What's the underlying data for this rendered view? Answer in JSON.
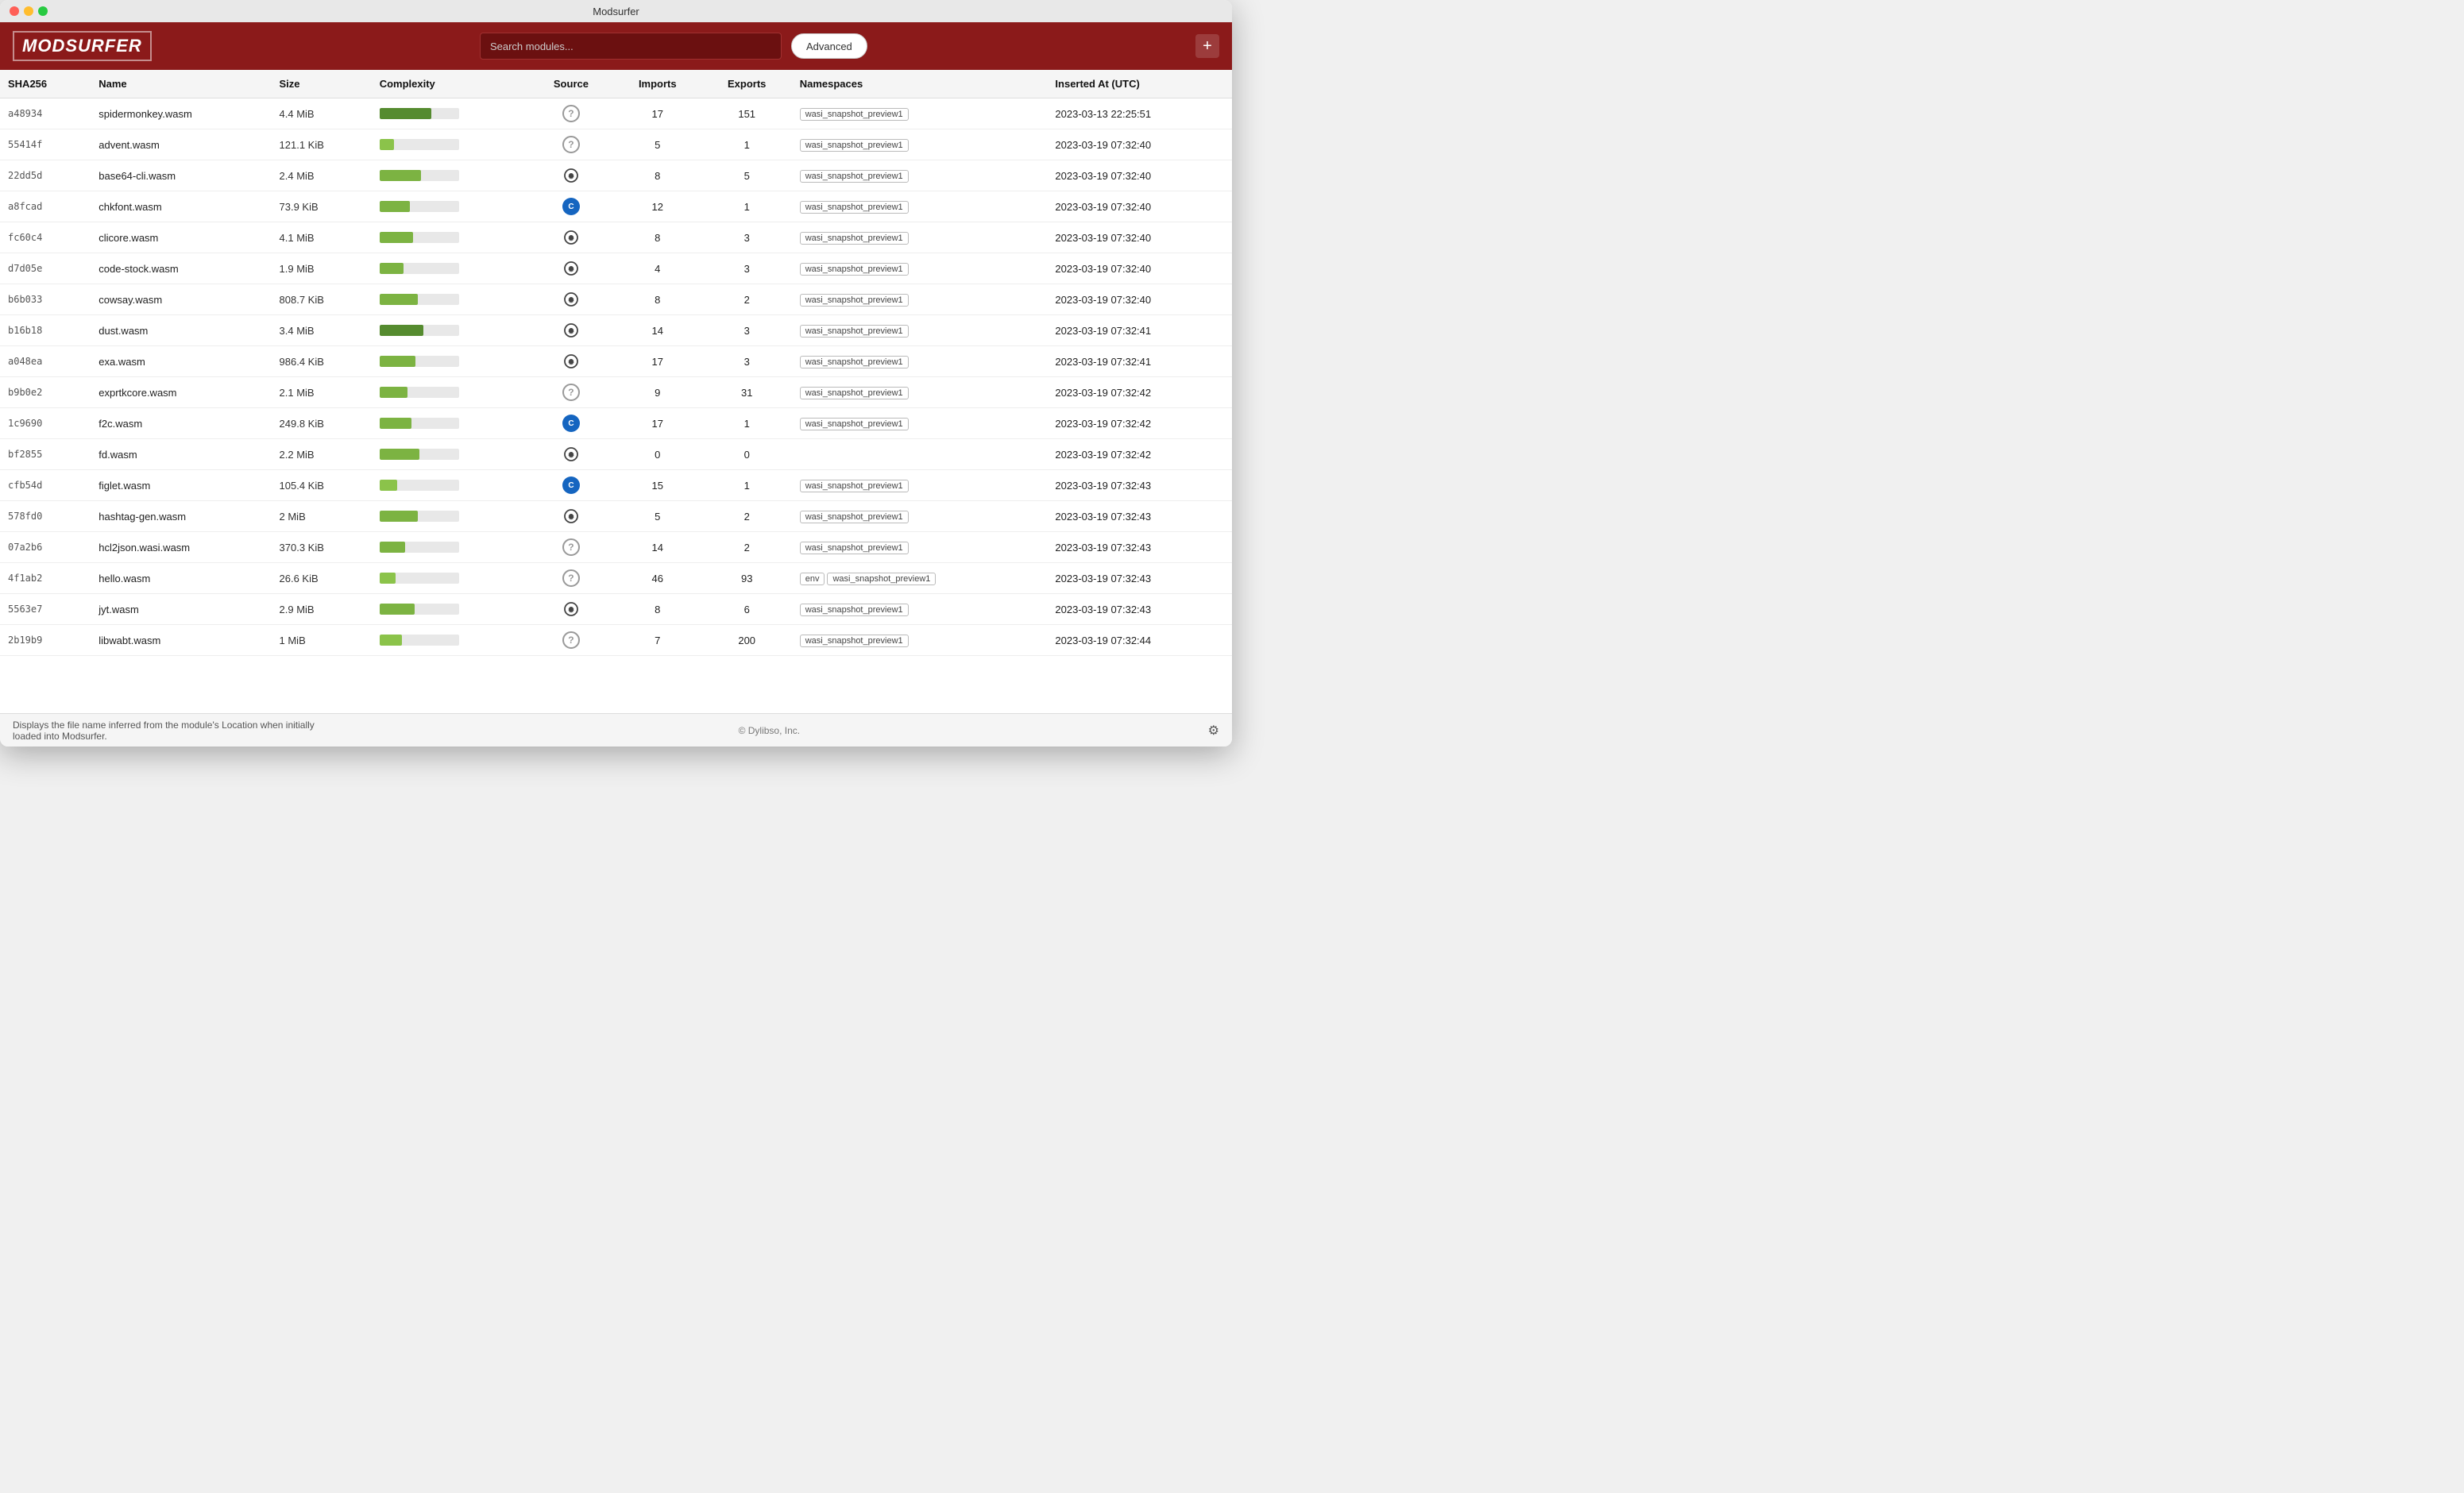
{
  "window": {
    "title": "Modsurfer"
  },
  "header": {
    "logo": "MODSURFER",
    "search_placeholder": "Search modules...",
    "advanced_label": "Advanced",
    "add_label": "+"
  },
  "table": {
    "columns": [
      "SHA256",
      "Name",
      "Size",
      "Complexity",
      "Source",
      "Imports",
      "Exports",
      "Namespaces",
      "Inserted At (UTC)"
    ],
    "rows": [
      {
        "sha": "a48934",
        "name": "spidermonkey.wasm",
        "size": "4.4 MiB",
        "complexity": 65,
        "source": "question",
        "imports": 17,
        "exports": 151,
        "namespaces": [
          "wasi_snapshot_preview1"
        ],
        "inserted": "2023-03-13 22:25:51"
      },
      {
        "sha": "55414f",
        "name": "advent.wasm",
        "size": "121.1 KiB",
        "complexity": 18,
        "source": "question",
        "imports": 5,
        "exports": 1,
        "namespaces": [
          "wasi_snapshot_preview1"
        ],
        "inserted": "2023-03-19 07:32:40"
      },
      {
        "sha": "22dd5d",
        "name": "base64-cli.wasm",
        "size": "2.4 MiB",
        "complexity": 52,
        "source": "rust",
        "imports": 8,
        "exports": 5,
        "namespaces": [
          "wasi_snapshot_preview1"
        ],
        "inserted": "2023-03-19 07:32:40"
      },
      {
        "sha": "a8fcad",
        "name": "chkfont.wasm",
        "size": "73.9 KiB",
        "complexity": 38,
        "source": "cpp",
        "imports": 12,
        "exports": 1,
        "namespaces": [
          "wasi_snapshot_preview1"
        ],
        "inserted": "2023-03-19 07:32:40"
      },
      {
        "sha": "fc60c4",
        "name": "clicore.wasm",
        "size": "4.1 MiB",
        "complexity": 42,
        "source": "rust",
        "imports": 8,
        "exports": 3,
        "namespaces": [
          "wasi_snapshot_preview1"
        ],
        "inserted": "2023-03-19 07:32:40"
      },
      {
        "sha": "d7d05e",
        "name": "code-stock.wasm",
        "size": "1.9 MiB",
        "complexity": 30,
        "source": "rust",
        "imports": 4,
        "exports": 3,
        "namespaces": [
          "wasi_snapshot_preview1"
        ],
        "inserted": "2023-03-19 07:32:40"
      },
      {
        "sha": "b6b033",
        "name": "cowsay.wasm",
        "size": "808.7 KiB",
        "complexity": 48,
        "source": "rust",
        "imports": 8,
        "exports": 2,
        "namespaces": [
          "wasi_snapshot_preview1"
        ],
        "inserted": "2023-03-19 07:32:40"
      },
      {
        "sha": "b16b18",
        "name": "dust.wasm",
        "size": "3.4 MiB",
        "complexity": 55,
        "source": "rust",
        "imports": 14,
        "exports": 3,
        "namespaces": [
          "wasi_snapshot_preview1"
        ],
        "inserted": "2023-03-19 07:32:41"
      },
      {
        "sha": "a048ea",
        "name": "exa.wasm",
        "size": "986.4 KiB",
        "complexity": 45,
        "source": "rust",
        "imports": 17,
        "exports": 3,
        "namespaces": [
          "wasi_snapshot_preview1"
        ],
        "inserted": "2023-03-19 07:32:41"
      },
      {
        "sha": "b9b0e2",
        "name": "exprtkcore.wasm",
        "size": "2.1 MiB",
        "complexity": 35,
        "source": "question",
        "imports": 9,
        "exports": 31,
        "namespaces": [
          "wasi_snapshot_preview1"
        ],
        "inserted": "2023-03-19 07:32:42"
      },
      {
        "sha": "1c9690",
        "name": "f2c.wasm",
        "size": "249.8 KiB",
        "complexity": 40,
        "source": "cpp",
        "imports": 17,
        "exports": 1,
        "namespaces": [
          "wasi_snapshot_preview1"
        ],
        "inserted": "2023-03-19 07:32:42"
      },
      {
        "sha": "bf2855",
        "name": "fd.wasm",
        "size": "2.2 MiB",
        "complexity": 50,
        "source": "rust",
        "imports": 0,
        "exports": 0,
        "namespaces": [],
        "inserted": "2023-03-19 07:32:42"
      },
      {
        "sha": "cfb54d",
        "name": "figlet.wasm",
        "size": "105.4 KiB",
        "complexity": 22,
        "source": "cpp",
        "imports": 15,
        "exports": 1,
        "namespaces": [
          "wasi_snapshot_preview1"
        ],
        "inserted": "2023-03-19 07:32:43"
      },
      {
        "sha": "578fd0",
        "name": "hashtag-gen.wasm",
        "size": "2 MiB",
        "complexity": 48,
        "source": "rust",
        "imports": 5,
        "exports": 2,
        "namespaces": [
          "wasi_snapshot_preview1"
        ],
        "inserted": "2023-03-19 07:32:43"
      },
      {
        "sha": "07a2b6",
        "name": "hcl2json.wasi.wasm",
        "size": "370.3 KiB",
        "complexity": 32,
        "source": "question",
        "imports": 14,
        "exports": 2,
        "namespaces": [
          "wasi_snapshot_preview1"
        ],
        "inserted": "2023-03-19 07:32:43"
      },
      {
        "sha": "4f1ab2",
        "name": "hello.wasm",
        "size": "26.6 KiB",
        "complexity": 20,
        "source": "question",
        "imports": 46,
        "exports": 93,
        "namespaces": [
          "env",
          "wasi_snapshot_preview1"
        ],
        "inserted": "2023-03-19 07:32:43"
      },
      {
        "sha": "5563e7",
        "name": "jyt.wasm",
        "size": "2.9 MiB",
        "complexity": 44,
        "source": "rust",
        "imports": 8,
        "exports": 6,
        "namespaces": [
          "wasi_snapshot_preview1"
        ],
        "inserted": "2023-03-19 07:32:43"
      },
      {
        "sha": "2b19b9",
        "name": "libwabt.wasm",
        "size": "1 MiB",
        "complexity": 28,
        "source": "question",
        "imports": 7,
        "exports": 200,
        "namespaces": [
          "wasi_snapshot_preview1"
        ],
        "inserted": "2023-03-19 07:32:44"
      }
    ]
  },
  "footer": {
    "hint": "Displays the file name inferred from the module's Location when initially loaded into Modsurfer.",
    "copyright": "© Dylibso, Inc."
  },
  "icons": {
    "gear": "⚙",
    "plus": "+",
    "question": "?",
    "rust_symbol": "⊛",
    "cpp_symbol": "C"
  }
}
